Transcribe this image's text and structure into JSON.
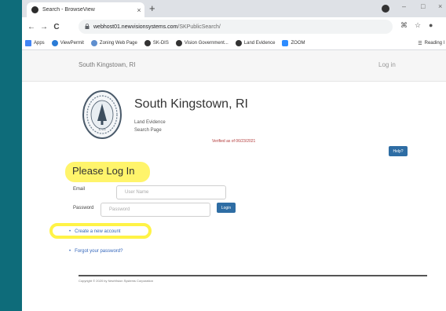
{
  "browser": {
    "tab_title": "Search - BrowseView",
    "tab_close": "×",
    "new_tab": "+",
    "url_host": "webhost01.newvisionsystems.com",
    "url_path": "/SKPublicSearch/",
    "window_controls": [
      "–",
      "□",
      "×"
    ],
    "toolbar_icons": [
      "←",
      "→",
      "C"
    ],
    "bookmarks": [
      {
        "label": "Apps",
        "color": "#4285f4"
      },
      {
        "label": "ViewPermit",
        "color": "#2a7bd6"
      },
      {
        "label": "Zoning Web Page",
        "color": "#5f8fcf"
      },
      {
        "label": "SK-DIS",
        "color": "#333333"
      },
      {
        "label": "Vision Government...",
        "color": "#333333"
      },
      {
        "label": "Land Evidence",
        "color": "#333333"
      },
      {
        "label": "ZOOM",
        "color": "#2d8cff"
      }
    ],
    "reading_list": "Reading l"
  },
  "site": {
    "brand": "South Kingstown, RI",
    "login_link": "Log in"
  },
  "header": {
    "title": "South Kingstown, RI",
    "sub1": "Land Evidence",
    "sub2": "Search Page",
    "verified": "Verified as of 06/23/2021",
    "help_label": "Help?",
    "seal_year": "1723"
  },
  "login": {
    "heading": "Please Log In",
    "email_label": "Email",
    "email_placeholder": "User Name",
    "password_label": "Password",
    "password_placeholder": "Password",
    "login_button": "Login",
    "create_account": "Create a new account",
    "forgot_password": "Forgot your password?"
  },
  "footer": {
    "copyright": "Copyright © 2020 by NewVision Systems Corporation"
  },
  "colors": {
    "highlight": "#fff346",
    "primary_button": "#2e6da4",
    "link": "#3366bb",
    "background_edge": "#0e6c7a"
  }
}
